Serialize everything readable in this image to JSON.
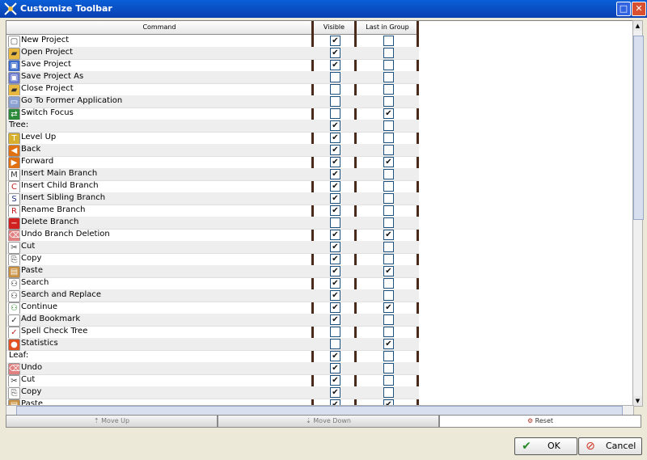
{
  "window": {
    "title": "Customize Toolbar"
  },
  "columns": {
    "command": "Command",
    "visible": "Visible",
    "last_in_group": "Last in Group"
  },
  "rows": [
    {
      "label": "New Project",
      "icon": "new-project-icon",
      "visible": true,
      "last": false
    },
    {
      "label": "Open Project",
      "icon": "open-folder-icon",
      "visible": true,
      "last": false
    },
    {
      "label": "Save Project",
      "icon": "save-disk-icon",
      "visible": true,
      "last": false
    },
    {
      "label": "Save Project As",
      "icon": "save-as-disk-icon",
      "visible": false,
      "last": false
    },
    {
      "label": "Close Project",
      "icon": "close-project-icon",
      "visible": false,
      "last": false
    },
    {
      "label": "Go To Former Application",
      "icon": "former-app-icon",
      "visible": false,
      "last": false
    },
    {
      "label": "Switch Focus",
      "icon": "switch-focus-icon",
      "visible": false,
      "last": true
    },
    {
      "label": "Tree:",
      "icon": "",
      "visible": true,
      "last": false
    },
    {
      "label": "Level Up",
      "icon": "level-up-icon",
      "visible": true,
      "last": false
    },
    {
      "label": "Back",
      "icon": "back-arrow-icon",
      "visible": true,
      "last": false
    },
    {
      "label": "Forward",
      "icon": "forward-arrow-icon",
      "visible": true,
      "last": true
    },
    {
      "label": "Insert Main Branch",
      "icon": "main-branch-icon",
      "visible": true,
      "last": false
    },
    {
      "label": "Insert Child Branch",
      "icon": "child-branch-icon",
      "visible": true,
      "last": false
    },
    {
      "label": "Insert Sibling Branch",
      "icon": "sibling-branch-icon",
      "visible": true,
      "last": false
    },
    {
      "label": "Rename Branch",
      "icon": "rename-icon",
      "visible": true,
      "last": false
    },
    {
      "label": "Delete Branch",
      "icon": "delete-icon",
      "visible": false,
      "last": false
    },
    {
      "label": "Undo Branch Deletion",
      "icon": "undo-eraser-icon",
      "visible": true,
      "last": true
    },
    {
      "label": "Cut",
      "icon": "scissors-icon",
      "visible": true,
      "last": false
    },
    {
      "label": "Copy",
      "icon": "copy-icon",
      "visible": true,
      "last": false
    },
    {
      "label": "Paste",
      "icon": "paste-icon",
      "visible": true,
      "last": true
    },
    {
      "label": "Search",
      "icon": "binoculars-icon",
      "visible": true,
      "last": false
    },
    {
      "label": "Search and Replace",
      "icon": "search-replace-icon",
      "visible": true,
      "last": false
    },
    {
      "label": "Continue",
      "icon": "continue-search-icon",
      "visible": true,
      "last": true
    },
    {
      "label": "Add Bookmark",
      "icon": "bookmark-icon",
      "visible": true,
      "last": false
    },
    {
      "label": "Spell Check Tree",
      "icon": "spellcheck-icon",
      "visible": false,
      "last": false
    },
    {
      "label": "Statistics",
      "icon": "statistics-icon",
      "visible": false,
      "last": true
    },
    {
      "label": "Leaf:",
      "icon": "",
      "visible": true,
      "last": false
    },
    {
      "label": "Undo",
      "icon": "undo-eraser-icon",
      "visible": true,
      "last": false
    },
    {
      "label": "Cut",
      "icon": "scissors-icon",
      "visible": true,
      "last": false
    },
    {
      "label": "Copy",
      "icon": "copy-icon",
      "visible": true,
      "last": false
    },
    {
      "label": "Paste",
      "icon": "paste-icon",
      "visible": true,
      "last": true
    }
  ],
  "buttons": {
    "move_up": "Move Up",
    "move_down": "Move Down",
    "reset": "Reset",
    "ok": "OK",
    "cancel": "Cancel"
  },
  "colors": {
    "titlebar": "#0A4FCC",
    "column_separator": "#4A2A1A",
    "row_alt": "#EEEEEE"
  }
}
